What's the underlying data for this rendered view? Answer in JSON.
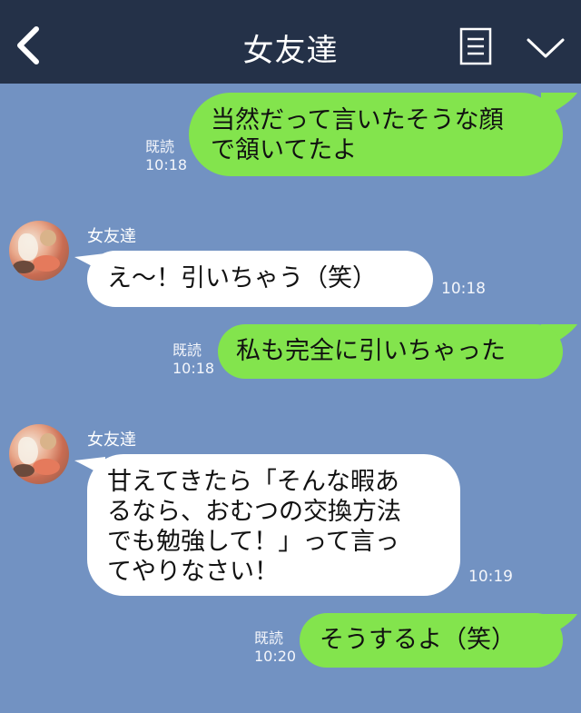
{
  "header": {
    "title": "女友達",
    "back_icon": "chevron-left-icon",
    "menu_icon": "list-menu-icon",
    "expand_icon": "chevron-down-icon",
    "background": "#243148"
  },
  "colors": {
    "chat_background": "#7292c2",
    "my_bubble": "#83e44d",
    "their_bubble": "#ffffff"
  },
  "messages": [
    {
      "sender": "me",
      "lines": [
        "当然だって言いたそうな顔",
        "で頷いてたよ"
      ],
      "read": "既読",
      "time": "10:18"
    },
    {
      "sender": "friend",
      "name": "女友達",
      "lines": [
        "え〜！引いちゃう（笑）"
      ],
      "time": "10:18"
    },
    {
      "sender": "me",
      "lines": [
        "私も完全に引いちゃった"
      ],
      "read": "既読",
      "time": "10:18"
    },
    {
      "sender": "friend",
      "name": "女友達",
      "lines": [
        "甘えてきたら「そんな暇あ",
        "るなら、おむつの交換方法",
        "でも勉強して！」って言っ",
        "てやりなさい！"
      ],
      "time": "10:19"
    },
    {
      "sender": "me",
      "lines": [
        "そうするよ（笑）"
      ],
      "read": "既読",
      "time": "10:20"
    }
  ]
}
